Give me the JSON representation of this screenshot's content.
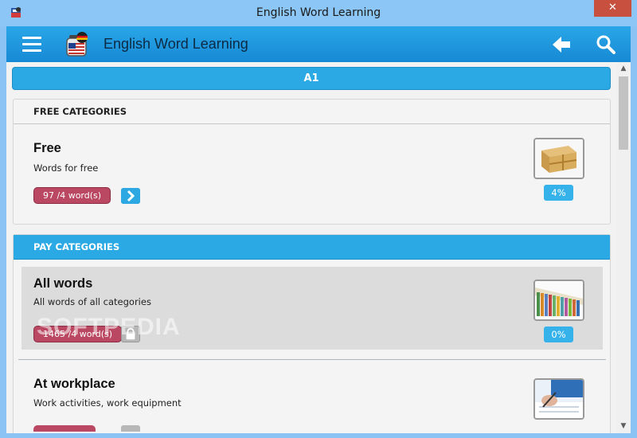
{
  "window": {
    "title": "English Word Learning",
    "close_label": "✕"
  },
  "appbar": {
    "title": "English Word Learning",
    "menu_icon": "hamburger-menu-icon",
    "back_icon": "arrow-left-icon",
    "search_icon": "magnifier-icon"
  },
  "level": {
    "label": "A1"
  },
  "free_section": {
    "header": "FREE CATEGORIES",
    "items": [
      {
        "title": "Free",
        "description": "Words for free",
        "count": "97 /4 word(s)",
        "progress": "4%",
        "icon": "gift-box-image"
      }
    ]
  },
  "pay_section": {
    "header": "PAY CATEGORIES",
    "items": [
      {
        "title": "All words",
        "description": "All words of all categories",
        "count": "1465 /4 word(s)",
        "progress": "0%",
        "icon": "books-image"
      },
      {
        "title": "At workplace",
        "description": "Work activities, work equipment",
        "icon": "writing-hand-image"
      }
    ]
  },
  "watermark": "SOFTPEDIA",
  "colors": {
    "accent": "#2ba9e4",
    "count_badge": "#bb4862",
    "progress_badge": "#36b2ea",
    "close": "#c7503f"
  }
}
